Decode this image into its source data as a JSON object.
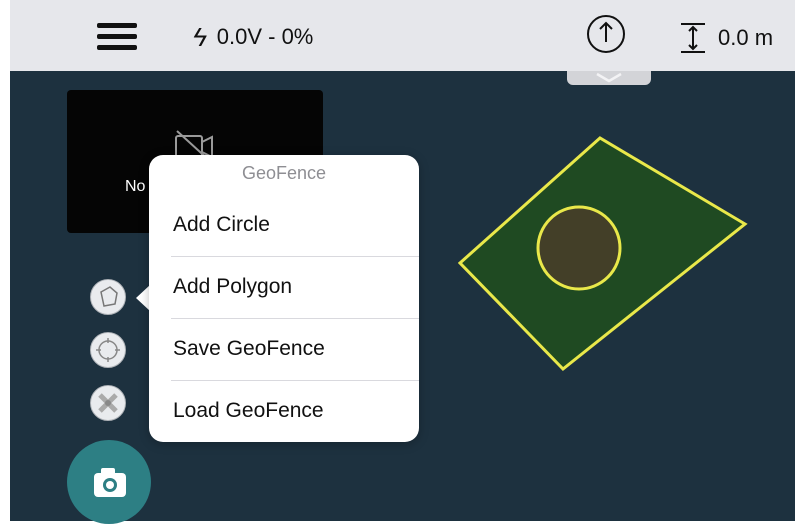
{
  "topbar": {
    "battery_text": "0.0V - 0%",
    "altitude_text": "0.0 m"
  },
  "video": {
    "no_signal_text": "No"
  },
  "popover": {
    "title": "GeoFence",
    "items": [
      {
        "label": "Add Circle"
      },
      {
        "label": "Add Polygon"
      },
      {
        "label": "Save GeoFence"
      },
      {
        "label": "Load GeoFence"
      }
    ]
  },
  "colors": {
    "map_background": "#1d313f",
    "geofence_fill": "#1f4a22",
    "geofence_stroke": "#e9e84a",
    "camera_button": "#2d7f84",
    "topbar": "#e6e7eb"
  },
  "icons": {
    "menu": "hamburger-icon",
    "battery": "bolt-icon",
    "compass": "compass-arrow-icon",
    "altitude": "altitude-icon",
    "video_off": "video-off-icon",
    "polygon_tool": "polygon-icon",
    "circle_tool": "circle-target-icon",
    "drone_tool": "drone-icon",
    "camera": "camera-icon"
  }
}
